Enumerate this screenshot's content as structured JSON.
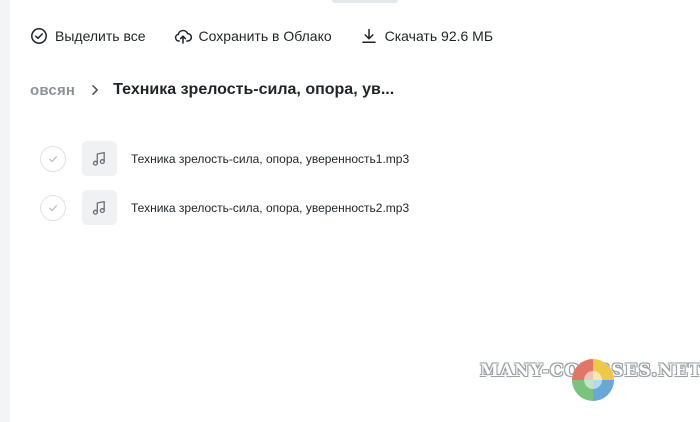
{
  "toolbar": {
    "select_all_label": "Выделить все",
    "save_to_cloud_label": "Сохранить в Облако",
    "download_label": "Скачать 92.6 МБ"
  },
  "breadcrumb": {
    "root": "овсян",
    "current": "Техника зрелость-сила, опора, ув..."
  },
  "files": [
    {
      "name": "Техника зрелость-сила, опора, уверенность1.mp3",
      "icon": "music-note-icon",
      "selected": false
    },
    {
      "name": "Техника зрелость-сила, опора, уверенность2.mp3",
      "icon": "music-note-icon",
      "selected": false
    }
  ],
  "watermark": {
    "text": "MANY-COURSES.NET"
  },
  "colors": {
    "text_primary": "#1f2329",
    "text_muted": "#8d9299",
    "thumb_bg": "#f0f1f3",
    "check_border": "#dfe2e6",
    "page_bg": "#f3f4f6"
  }
}
